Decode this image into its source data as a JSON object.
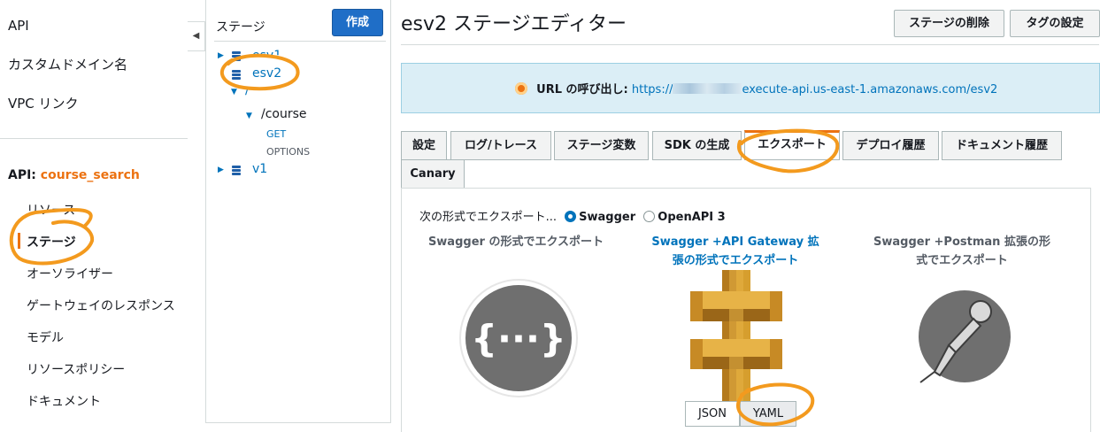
{
  "left_nav": {
    "top_links": [
      "API",
      "カスタムドメイン名",
      "VPC リンク"
    ],
    "api_prefix": "API:",
    "api_name": "course_search",
    "sub_items": [
      "リソース",
      "ステージ",
      "オーソライザー",
      "ゲートウェイのレスポンス",
      "モデル",
      "リソースポリシー",
      "ドキュメント"
    ],
    "active_item": "ステージ"
  },
  "stage_panel": {
    "title": "ステージ",
    "create_label": "作成",
    "tree": {
      "hidden_stage": "esv1",
      "selected_stage": "esv2",
      "root_resource": "/",
      "resource": "/course",
      "methods": [
        "GET",
        "OPTIONS"
      ],
      "other_stage": "v1"
    }
  },
  "main": {
    "title": "esv2 ステージエディター",
    "header_buttons": {
      "delete_stage": "ステージの削除",
      "tag_settings": "タグの設定"
    },
    "invoke_url": {
      "label": "URL の呼び出し:",
      "prefix": "https://",
      "suffix": "execute-api.us-east-1.amazonaws.com/esv2"
    },
    "tabs": [
      "設定",
      "ログ/トレース",
      "ステージ変数",
      "SDK の生成",
      "エクスポート",
      "デプロイ履歴",
      "ドキュメント履歴",
      "Canary"
    ],
    "active_tab": "エクスポート",
    "export": {
      "format_prompt": "次の形式でエクスポート...",
      "formats": [
        "Swagger",
        "OpenAPI 3"
      ],
      "selected_format": "Swagger",
      "columns": [
        {
          "title": "Swagger の形式でエクスポート",
          "icon": "swagger-icon"
        },
        {
          "title": "Swagger +API Gateway 拡張の形式でエクスポート",
          "icon": "api-gateway-icon"
        },
        {
          "title": "Swagger +Postman 拡張の形式でエクスポート",
          "icon": "postman-icon"
        }
      ],
      "file_types": [
        "JSON",
        "YAML"
      ],
      "swagger_glyph": "{···}"
    }
  },
  "colors": {
    "accent_orange": "#ec7211",
    "link_blue": "#0073bb",
    "primary_button": "#1f6ec7",
    "info_bg": "#dbeef6",
    "gateway_gold": "#d69e2e",
    "swagger_gray": "#6f6f6f"
  }
}
